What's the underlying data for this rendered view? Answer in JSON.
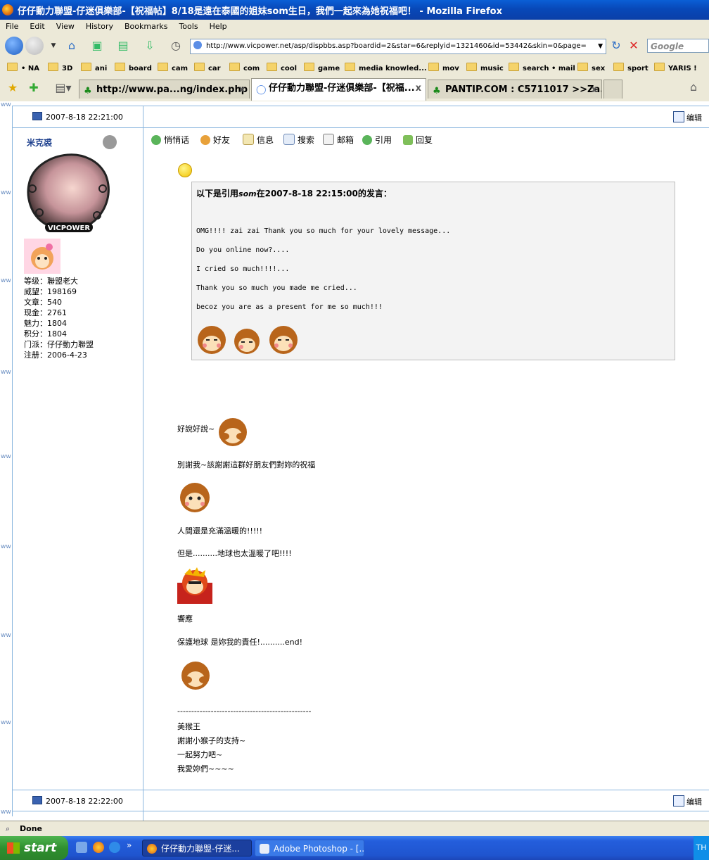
{
  "window": {
    "title": "仔仔動力聯盟-仔迷俱樂部-【祝福帖】8/18是遠在泰國的姐妹som生日，我們一起來為她祝福吧！ - Mozilla Firefox"
  },
  "menu": [
    "File",
    "Edit",
    "View",
    "History",
    "Bookmarks",
    "Tools",
    "Help"
  ],
  "navbar": {
    "url": "http://www.vicpower.net/asp/dispbbs.asp?boardid=2&star=6&replyid=1321460&id=53442&skin=0&page=",
    "search_placeholder": "Google"
  },
  "bookmarks": [
    "• NA",
    "3D",
    "ani",
    "board",
    "cam",
    "car",
    "com",
    "cool",
    "game",
    "media knowled...",
    "mov",
    "music",
    "search • mail",
    "sex",
    "sport",
    "YARIS !"
  ],
  "tabs": [
    {
      "label": "http://www.pa...ng/index.php"
    },
    {
      "label": "仔仔動力聯盟-仔迷俱樂部-【祝福..."
    },
    {
      "label": "PANTIP.COM : C5711017 >>Za..."
    }
  ],
  "post": {
    "time_top": "2007-8-18  22:21:00",
    "time_bottom": "2007-8-18  22:22:00",
    "edit_label": "编辑",
    "username": "米克裘",
    "user_stats": [
      "等级：聯盟老大",
      "威望：198169",
      "文章：540",
      "现金：2761",
      "魅力：1804",
      "积分：1804",
      "门派：仔仔動力聯盟",
      "注册：2006-4-23"
    ],
    "avatar_label": "VICPOWER",
    "actions": [
      "悄悄话",
      "好友",
      "信息",
      "搜索",
      "邮箱",
      "引用",
      "回复"
    ],
    "quote_header_prefix": "以下是引用",
    "quote_author": "som",
    "quote_header_suffix": "在2007-8-18 22:15:00的发言：",
    "quote_lines": [
      "OMG!!!! zai zai Thank you so much for your lovely message...",
      "Do you online now?....",
      "I cried so much!!!!...",
      "Thank you so much you made me cried...",
      "becoz you are as a present for me so much!!!"
    ],
    "body": [
      "好說好說~",
      "別謝我~該謝謝這群好朋友們對妳的祝福",
      "人間還是充滿溫暖的!!!!!",
      "但是..........地球也太溫暖了吧!!!!",
      "響應",
      "保護地球  是妳我的責任!..........end!",
      "------------------------------------------------",
      "美猴王",
      "謝謝小猴子的支持~",
      "一起努力吧~",
      "我愛妳們~~~~"
    ]
  },
  "statusbar": {
    "text": "Done"
  },
  "taskbar": {
    "start": "start",
    "tasks": [
      "仔仔動力聯盟-仔迷...",
      "Adobe Photoshop - [..."
    ],
    "tray_text": "TH"
  },
  "colors": {
    "title_bar": "#0848b8",
    "chrome": "#ece9d8",
    "border_blue": "#8bb6de",
    "quote_bg": "#f3f3f3",
    "taskbar": "#245edc",
    "start_green": "#2f8f2f"
  }
}
